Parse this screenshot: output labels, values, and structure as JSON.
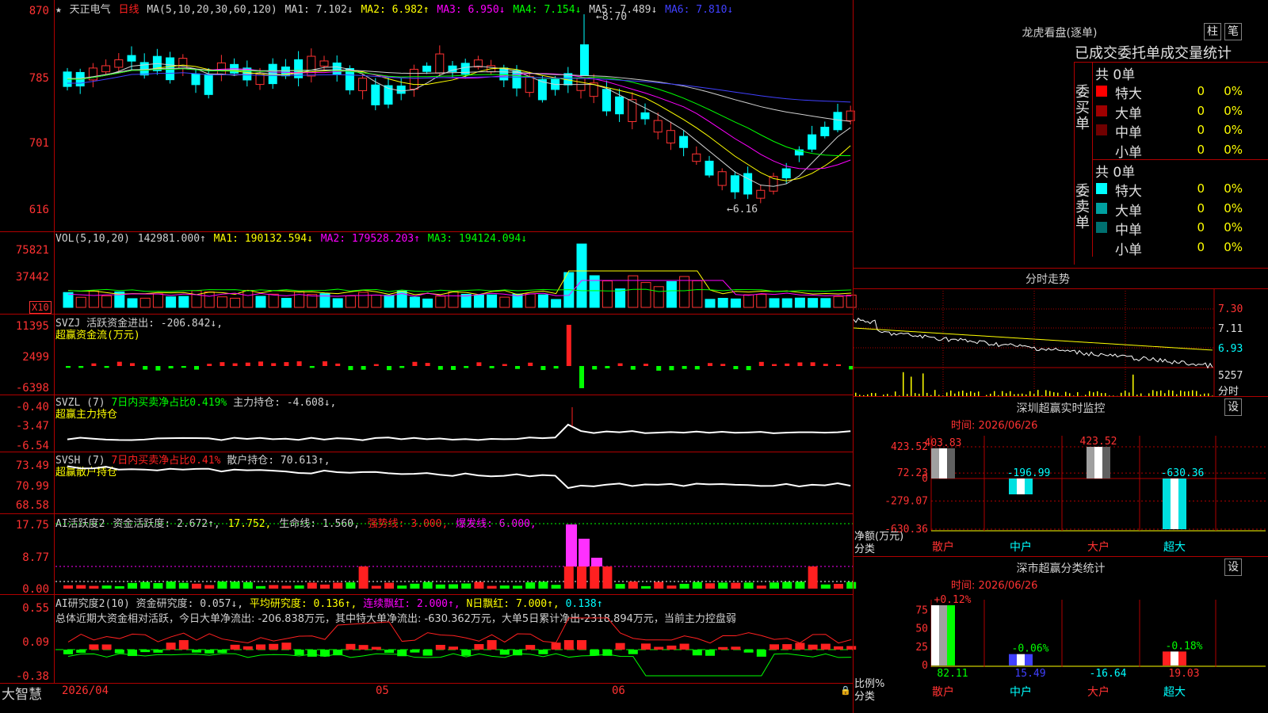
{
  "main_chart": {
    "star": "★",
    "stock_name": "天正电气",
    "period": "日线",
    "ma_title": "MA(5,10,20,30,60,120)",
    "ma1": "MA1: 7.102↓",
    "ma2": "MA2: 6.982↑",
    "ma3": "MA3: 6.950↓",
    "ma4": "MA4: 7.154↓",
    "ma5": "MA5: 7.489↓",
    "ma6": "MA6: 7.810↓",
    "y_ticks": [
      "870",
      "785",
      "701",
      "616"
    ],
    "high_marker": "8.70",
    "low_marker": "6.16"
  },
  "vol_panel": {
    "title": "VOL(5,10,20)",
    "value": "142981.000↑",
    "ma1": "MA1: 190132.594↓",
    "ma2": "MA2: 179528.203↑",
    "ma3": "MA3: 194124.094↓",
    "y_ticks": [
      "75821",
      "37442"
    ],
    "unit": "X10"
  },
  "svzj_panel": {
    "line1": "SVZJ  活跃资金进出: -206.842↓,",
    "line2": "超赢资金流(万元)",
    "y_ticks": [
      "11395",
      "2499",
      "-6398"
    ]
  },
  "svzl_panel": {
    "name": "SVZL (7)",
    "ratio": "7日内买卖净占比0.419%",
    "hold": "主力持仓: -4.608↓,",
    "line2": "超赢主力持仓",
    "y_ticks": [
      "-0.40",
      "-3.47",
      "-6.54"
    ]
  },
  "svsh_panel": {
    "name": "SVSH (7)",
    "ratio": "7日内买卖净占比0.41%",
    "hold": "散户持仓: 70.613↑,",
    "line2": "超赢散户持仓",
    "y_ticks": [
      "73.49",
      "70.99",
      "68.58"
    ]
  },
  "ai_active_panel": {
    "name": "AI活跃度2",
    "v1": "资金活跃度: 2.672↑,",
    "v2": "17.752,",
    "v3": "生命线: 1.560,",
    "v4": "强势线: 3.000,",
    "v5": "爆发线: 6.000,",
    "y_ticks": [
      "17.75",
      "8.77",
      "0.00"
    ]
  },
  "ai_research_panel": {
    "name": "AI研究度2(10)",
    "v1": "资金研究度: 0.057↓,",
    "v2": "平均研究度: 0.136↑,",
    "v3": "连续飘红: 2.000↑,",
    "v4": "N日飘红: 7.000↑,",
    "v5": "0.138↑",
    "summary": "总体近期大资金相对活跃，今日大单净流出: -206.838万元，其中特大单净流出: -630.362万元，大单5日累计净出-2318.894万元，当前主力控盘弱",
    "y_ticks": [
      "0.55",
      "0.09",
      "-0.38"
    ]
  },
  "bottom_bar": {
    "brand": "大智慧",
    "date": "2026/04",
    "m05": "05",
    "m06": "06"
  },
  "dragon_tiger": {
    "title": "龙虎看盘(逐单)",
    "btn1": "柱",
    "btn2": "笔",
    "header": "已成交委托单成交量统计",
    "buy_label": "委买单",
    "sell_label": "委卖单",
    "buy_total": "共 0单",
    "sell_total": "共 0单",
    "buy_rows": [
      {
        "label": "特大",
        "value": "0",
        "pct": "0%",
        "color": "#ff0000"
      },
      {
        "label": "大单",
        "value": "0",
        "pct": "0%",
        "color": "#a00000"
      },
      {
        "label": "中单",
        "value": "0",
        "pct": "0%",
        "color": "#700000"
      },
      {
        "label": "小单",
        "value": "0",
        "pct": "0%",
        "color": "#000000"
      }
    ],
    "sell_rows": [
      {
        "label": "特大",
        "value": "0",
        "pct": "0%",
        "color": "#00ffff"
      },
      {
        "label": "大单",
        "value": "0",
        "pct": "0%",
        "color": "#00a0a0"
      },
      {
        "label": "中单",
        "value": "0",
        "pct": "0%",
        "color": "#007070"
      },
      {
        "label": "小单",
        "value": "0",
        "pct": "0%",
        "color": "#000000"
      }
    ]
  },
  "intraday": {
    "title": "分时走势",
    "y_ticks": [
      "7.30",
      "7.11",
      "6.93"
    ],
    "vol_label": "5257",
    "vol_unit": "分时"
  },
  "monitor": {
    "title": "深圳超赢实时监控",
    "btn": "设",
    "time": "时间: 2026/06/26",
    "y_ticks": [
      "423.52",
      "72.23",
      "0",
      "-279.07",
      "-630.36"
    ],
    "y_caption1": "净额(万元)",
    "y_caption2": "分类",
    "categories": [
      "散户",
      "中户",
      "大户",
      "超大"
    ],
    "bar_labels": [
      "403.83",
      "-196.99",
      "423.52",
      "-630.36"
    ],
    "values": [
      403.83,
      -196.99,
      423.52,
      -630.36
    ]
  },
  "classify": {
    "title": "深市超赢分类统计",
    "btn": "设",
    "time": "时间: 2026/06/26",
    "y_ticks": [
      "75",
      "50",
      "25",
      "0"
    ],
    "y_caption1": "比例%",
    "y_caption2": "分类",
    "categories": [
      "散户",
      "中户",
      "大户",
      "超大"
    ],
    "top_labels": [
      "+0.12%",
      "-0.06%",
      "",
      "-0.18%"
    ],
    "bottom_labels": [
      "82.11",
      "15.49",
      "-16.64",
      "19.03"
    ],
    "values": [
      82.11,
      15.49,
      -16.64,
      19.03
    ]
  }
}
